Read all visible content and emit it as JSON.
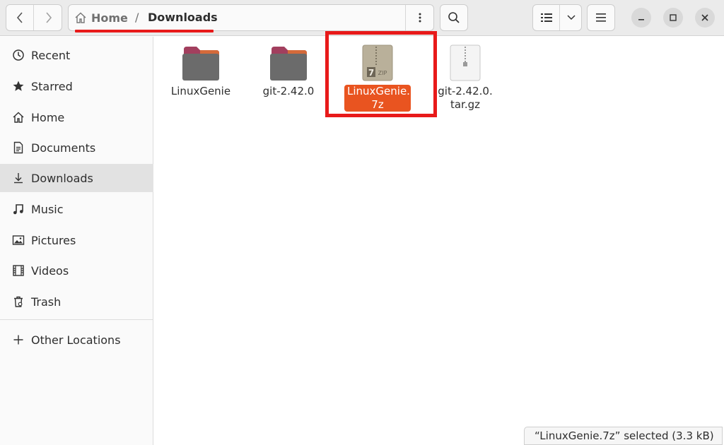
{
  "header": {
    "path": {
      "home_label": "Home",
      "separator": "/",
      "current": "Downloads"
    }
  },
  "sidebar": {
    "items": [
      {
        "label": "Recent",
        "icon": "clock-icon"
      },
      {
        "label": "Starred",
        "icon": "star-icon"
      },
      {
        "label": "Home",
        "icon": "home-icon"
      },
      {
        "label": "Documents",
        "icon": "document-icon"
      },
      {
        "label": "Downloads",
        "icon": "download-icon",
        "active": true
      },
      {
        "label": "Music",
        "icon": "music-icon"
      },
      {
        "label": "Pictures",
        "icon": "picture-icon"
      },
      {
        "label": "Videos",
        "icon": "video-icon"
      },
      {
        "label": "Trash",
        "icon": "trash-icon"
      }
    ],
    "other_locations": {
      "label": "Other Locations",
      "icon": "plus-icon"
    }
  },
  "files": [
    {
      "name": "LinuxGenie",
      "type": "folder"
    },
    {
      "name": "git-2.42.0",
      "type": "folder"
    },
    {
      "name_line1": "LinuxGenie.",
      "name_line2": "7z",
      "type": "7zip-archive",
      "selected": true,
      "badge": "7",
      "badge_sub": "ZIP"
    },
    {
      "name_line1": "git-2.42.0.",
      "name_line2": "tar.gz",
      "type": "tar-archive"
    }
  ],
  "status": {
    "text": "“LinuxGenie.7z” selected  (3.3 kB)"
  },
  "colors": {
    "accent": "#e95420",
    "annotation": "#e81a1a",
    "folder": "#6b6b6b",
    "folder_tab": "#a23f5e"
  }
}
